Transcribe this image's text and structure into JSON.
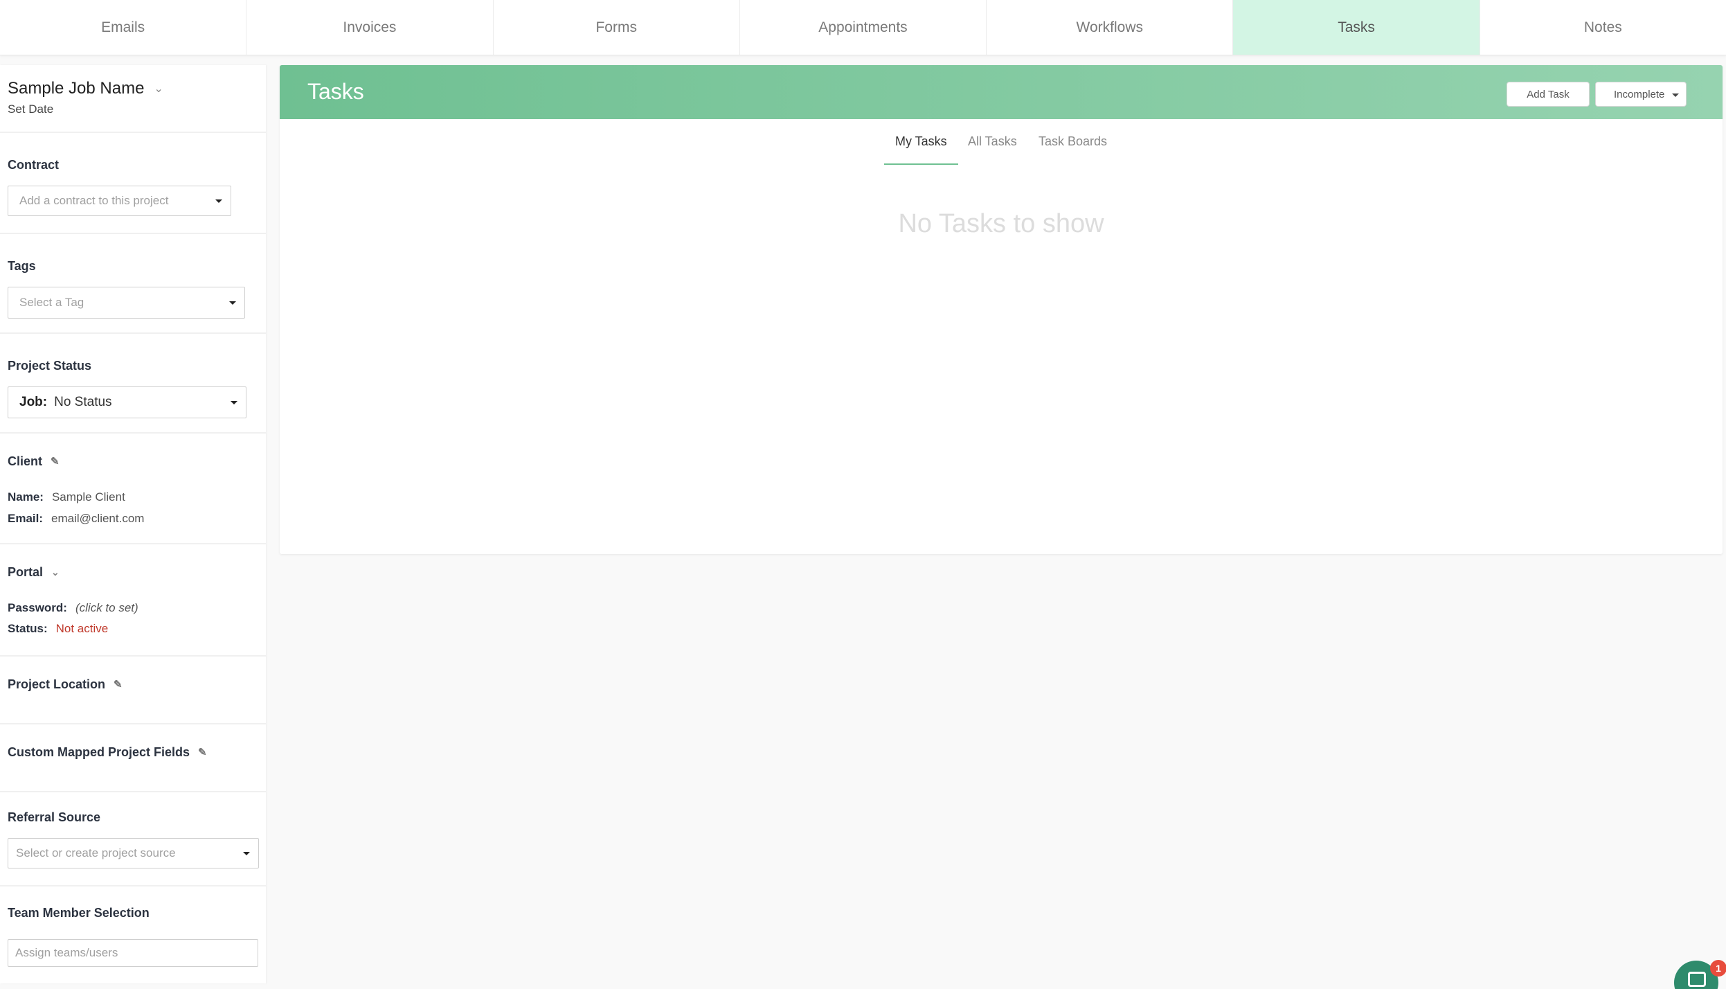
{
  "top_tabs": [
    {
      "label": "Emails"
    },
    {
      "label": "Invoices"
    },
    {
      "label": "Forms"
    },
    {
      "label": "Appointments"
    },
    {
      "label": "Workflows"
    },
    {
      "label": "Tasks",
      "active": true
    },
    {
      "label": "Notes"
    }
  ],
  "sidebar": {
    "job_name": "Sample Job Name",
    "set_date": "Set Date",
    "contract": {
      "heading": "Contract",
      "placeholder": "Add a contract to this project"
    },
    "tags": {
      "heading": "Tags",
      "placeholder": "Select a Tag"
    },
    "project_status": {
      "heading": "Project Status",
      "label": "Job:",
      "value": "No Status"
    },
    "client": {
      "heading": "Client",
      "name_label": "Name:",
      "name_value": "Sample Client",
      "email_label": "Email:",
      "email_value": "email@client.com"
    },
    "portal": {
      "heading": "Portal",
      "password_label": "Password:",
      "password_value": "(click to set)",
      "status_label": "Status:",
      "status_value": "Not active"
    },
    "project_location": {
      "heading": "Project Location"
    },
    "custom_fields": {
      "heading": "Custom Mapped Project Fields"
    },
    "referral_source": {
      "heading": "Referral Source",
      "placeholder": "Select or create project source"
    },
    "team_member": {
      "heading": "Team Member Selection",
      "placeholder": "Assign teams/users"
    }
  },
  "main": {
    "title": "Tasks",
    "add_task_label": "Add Task",
    "filter_label": "Incomplete",
    "subtabs": [
      "My Tasks",
      "All Tasks",
      "Task Boards"
    ],
    "active_subtab": "My Tasks",
    "empty_message": "No Tasks to show"
  },
  "chat": {
    "badge_count": "1"
  },
  "colors": {
    "accent": "#6fc092",
    "active_tab_bg": "#d3f5e4",
    "status_inactive": "#c0392b",
    "chat": "#2e8b6c",
    "badge": "#e74c3c"
  },
  "icons": [
    "chevron-down-icon",
    "pencil-icon",
    "caret-down-icon",
    "chat-icon"
  ]
}
